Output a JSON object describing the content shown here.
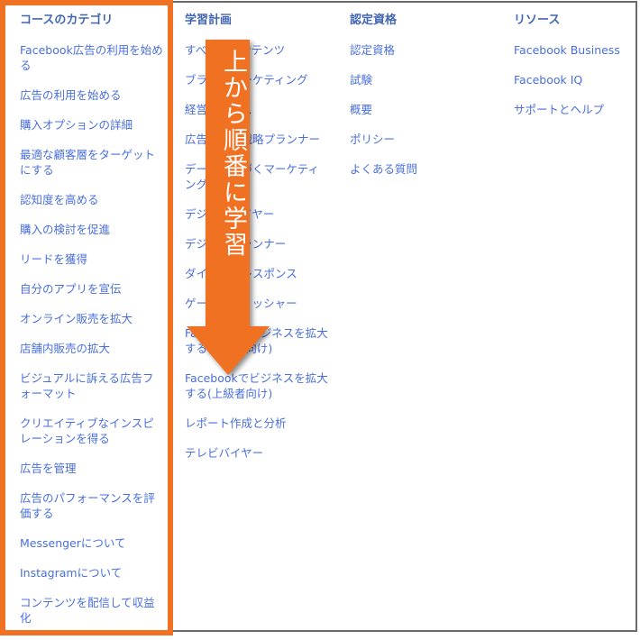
{
  "columns": [
    {
      "title": "コースのカテゴリ",
      "items": [
        "Facebook広告の利用を始める",
        "広告の利用を始める",
        "購入オプションの詳細",
        "最適な顧客層をターゲットにする",
        "認知度を高める",
        "購入の検討を促進",
        "リードを獲得",
        "自分のアプリを宣伝",
        "オンライン販売を拡大",
        "店舗内販売の拡大",
        "ビジュアルに訴える広告フォーマット",
        "クリエイティブなインスピレーションを得る",
        "広告を管理",
        "広告のパフォーマンスを評価する",
        "Messengerについて",
        "Instagramについて",
        "コンテンツを配信して収益化"
      ]
    },
    {
      "title": "学習計画",
      "items": [
        "すべてのコンテンツ",
        "ブランドマーケティング",
        "経営者クラス",
        "広告代理店戦略プランナー",
        "データに基づくマーケティング",
        "デジタルバイヤー",
        "デジタルプランナー",
        "ダイレクトレスポンス",
        "ゲームパブリッシャー",
        "Facebookでビジネスを拡大する(初心者向け)",
        "Facebookでビジネスを拡大する(上級者向け)",
        "レポート作成と分析",
        "テレビバイヤー"
      ]
    },
    {
      "title": "認定資格",
      "items": [
        "認定資格",
        "試験",
        "概要",
        "ポリシー",
        "よくある質問"
      ]
    },
    {
      "title": "リソース",
      "items": [
        "Facebook Business",
        "Facebook IQ",
        "サポートとヘルプ"
      ]
    }
  ],
  "annotation": {
    "text": "上から順番に学習",
    "color": "#f07122",
    "icon": "arrow-down-icon"
  },
  "colors": {
    "link": "#4a6fdc",
    "heading": "#4267b2",
    "highlight": "#f07122"
  }
}
